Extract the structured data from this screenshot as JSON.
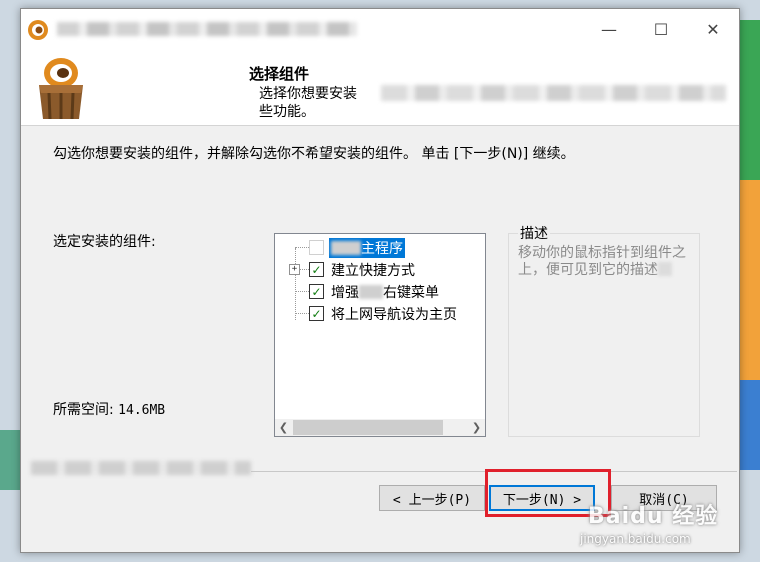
{
  "window": {
    "controls": {
      "minimize": "—",
      "maximize": "☐",
      "close": "✕"
    }
  },
  "header": {
    "title": "选择组件",
    "description_line1": "选择你想要安装",
    "description_line2": "些功能。"
  },
  "instruction": "勾选你想要安装的组件，并解除勾选你不希望安装的组件。 单击 [下一步(N)] 继续。",
  "components_label": "选定安装的组件:",
  "space_required_label": "所需空间:",
  "space_required_value": "14.6MB",
  "components": [
    {
      "label": "主程序",
      "checked": true,
      "enabled": false,
      "selected": true
    },
    {
      "label": "建立快捷方式",
      "checked": true,
      "enabled": true,
      "expandable": true
    },
    {
      "label_prefix": "增强",
      "label_suffix": "右键菜单",
      "checked": true,
      "enabled": true
    },
    {
      "label": "将上网导航设为主页",
      "checked": true,
      "enabled": true
    }
  ],
  "description_box": {
    "title": "描述",
    "text": "移动你的鼠标指针到组件之上，便可见到它的描述"
  },
  "buttons": {
    "back": "< 上一步(P)",
    "next": "下一步(N) >",
    "cancel": "取消(C)"
  },
  "watermark": {
    "brand": "Baidu 经验",
    "url": "jingyan.baidu.com"
  },
  "colors": {
    "accent": "#0078d7",
    "highlight": "#e0202c",
    "check": "#107c10"
  }
}
